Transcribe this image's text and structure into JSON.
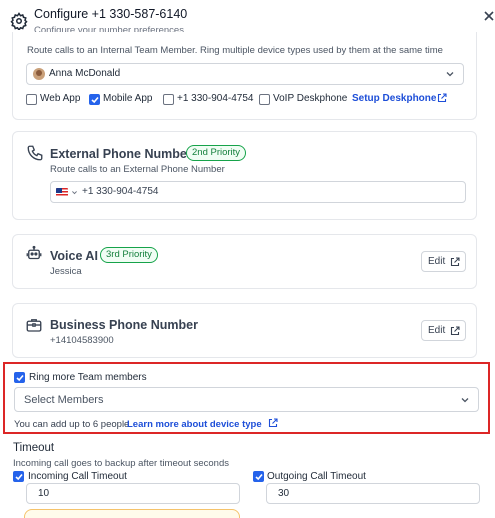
{
  "header": {
    "title": "Configure +1 330-587-6140",
    "subtitle": "Configure your number preferences"
  },
  "team_member": {
    "description": "Route calls to an Internal Team Member. Ring multiple device types used by them at the same time",
    "selected_member": "Anna McDonald",
    "devices": [
      {
        "label": "Web App",
        "checked": false
      },
      {
        "label": "Mobile App",
        "checked": true
      },
      {
        "label": "+1 330-904-4754",
        "checked": false
      },
      {
        "label": "VoIP Deskphone",
        "checked": false
      }
    ],
    "setup_link": "Setup Deskphone"
  },
  "external_phone": {
    "title": "External Phone Number",
    "priority": "2nd Priority",
    "description": "Route calls to an External Phone Number",
    "number": "+1 330-904-4754"
  },
  "voice_ai": {
    "title": "Voice AI",
    "priority": "3rd Priority",
    "subtitle": "Jessica",
    "edit_label": "Edit"
  },
  "business_phone": {
    "title": "Business Phone Number",
    "subtitle": "+14104583900",
    "edit_label": "Edit"
  },
  "ring_more": {
    "label": "Ring more Team members",
    "checked": true,
    "select_placeholder": "Select Members",
    "helper_text": "You can add up to 6 people.",
    "learn_more": "Learn more about device type"
  },
  "timeout": {
    "title": "Timeout",
    "description": "Incoming call goes to backup after timeout seconds",
    "incoming_label": "Incoming Call Timeout",
    "incoming_value": "10",
    "outgoing_label": "Outgoing Call Timeout",
    "outgoing_value": "30"
  },
  "colors": {
    "accent": "#2563eb",
    "link": "#1d4ed8",
    "badge_green": "#16a34a",
    "highlight_red": "#dc2626"
  },
  "icons": [
    "gear-icon",
    "close-icon",
    "chevron-down-icon",
    "external-link-icon",
    "phone-icon",
    "robot-icon",
    "briefcase-icon",
    "checkmark-icon"
  ]
}
